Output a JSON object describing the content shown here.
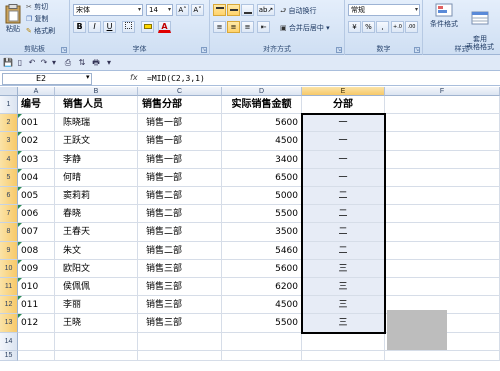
{
  "ribbon": {
    "clipboard": {
      "paste": "粘贴",
      "cut": "剪切",
      "copy": "复制",
      "format_painter": "格式刷",
      "label": "剪贴板"
    },
    "font": {
      "name": "宋体",
      "size": "14",
      "bold": "B",
      "italic": "I",
      "underline": "U",
      "grow": "A˄",
      "shrink": "A˅",
      "font_color": "A",
      "label": "字体"
    },
    "alignment": {
      "wrap": "自动换行",
      "merge": "合并后居中 ▾",
      "label": "对齐方式"
    },
    "number": {
      "format": "常规",
      "currency": "¥",
      "percent": "%",
      "comma": ",",
      "inc": "+.0",
      "dec": ".00",
      "label": "数字"
    },
    "styles": {
      "conditional": "条件格式",
      "table": "套用\n表格格式",
      "label": "样式"
    }
  },
  "formula_bar": {
    "name_box": "E2",
    "fx": "fx",
    "formula": "=MID(C2,3,1)"
  },
  "columns": [
    "A",
    "B",
    "C",
    "D",
    "E",
    "F"
  ],
  "headers": [
    "编号",
    "销售人员",
    "销售分部",
    "实际销售金额",
    "分部"
  ],
  "rows": [
    [
      "001",
      "陈晓瑞",
      "销售一部",
      "5600",
      "一"
    ],
    [
      "002",
      "王跃文",
      "销售一部",
      "4500",
      "一"
    ],
    [
      "003",
      "李静",
      "销售一部",
      "3400",
      "一"
    ],
    [
      "004",
      "何晴",
      "销售一部",
      "6500",
      "一"
    ],
    [
      "005",
      "窦莉莉",
      "销售二部",
      "5000",
      "二"
    ],
    [
      "006",
      "春晓",
      "销售二部",
      "5500",
      "二"
    ],
    [
      "007",
      "王春天",
      "销售二部",
      "3500",
      "二"
    ],
    [
      "008",
      "朱文",
      "销售二部",
      "5460",
      "二"
    ],
    [
      "009",
      "欧阳文",
      "销售三部",
      "5600",
      "三"
    ],
    [
      "010",
      "侯佩佩",
      "销售三部",
      "6200",
      "三"
    ],
    [
      "011",
      "李丽",
      "销售三部",
      "4500",
      "三"
    ],
    [
      "012",
      "王晓",
      "销售三部",
      "5500",
      "三"
    ]
  ],
  "row_numbers": [
    "1",
    "2",
    "3",
    "4",
    "5",
    "6",
    "7",
    "8",
    "9",
    "10",
    "11",
    "12",
    "13",
    "14",
    "15"
  ],
  "colors": {
    "ribbon": "#dbe6f5",
    "selection": "#e7ecf6",
    "header_selected": "#f7c969"
  }
}
